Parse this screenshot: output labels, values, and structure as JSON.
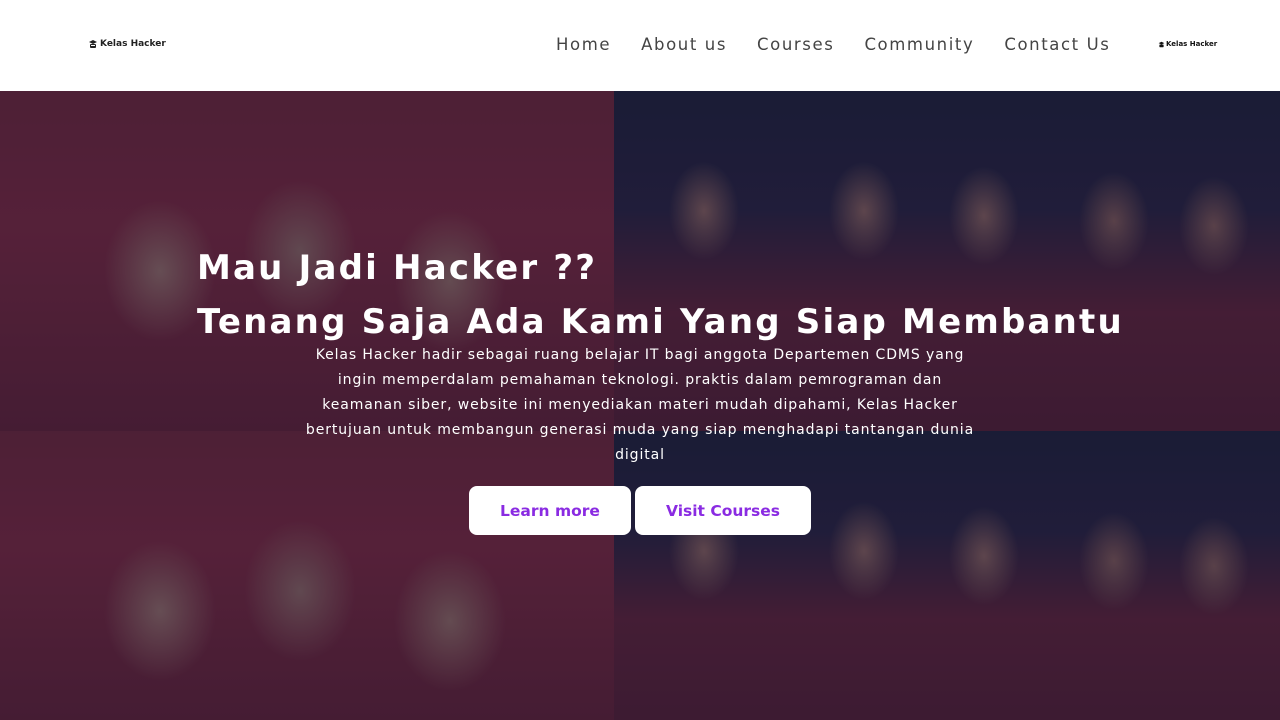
{
  "navbar": {
    "brand_label": "Kelas Hacker",
    "brand_icon": "hacker-icon",
    "links": [
      {
        "label": "Home"
      },
      {
        "label": "About us"
      },
      {
        "label": "Courses"
      },
      {
        "label": "Community"
      },
      {
        "label": "Contact Us"
      }
    ],
    "right_brand_label": "Kelas Hacker"
  },
  "hero": {
    "title_line1": "Mau Jadi Hacker ??",
    "title_line2": "Tenang Saja Ada Kami Yang Siap Membantu",
    "description": "Kelas Hacker hadir sebagai ruang belajar IT bagi anggota Departemen CDMS yang ingin memperdalam pemahaman teknologi. praktis dalam pemrograman dan keamanan siber, website ini menyediakan materi mudah dipahami, Kelas Hacker bertujuan untuk membangun generasi muda yang siap menghadapi tantangan dunia digital",
    "learn_more_label": "Learn more",
    "visit_courses_label": "Visit Courses"
  },
  "colors": {
    "button_text": "#8a2be2",
    "overlay": "#181834",
    "nav_text": "#444444"
  }
}
